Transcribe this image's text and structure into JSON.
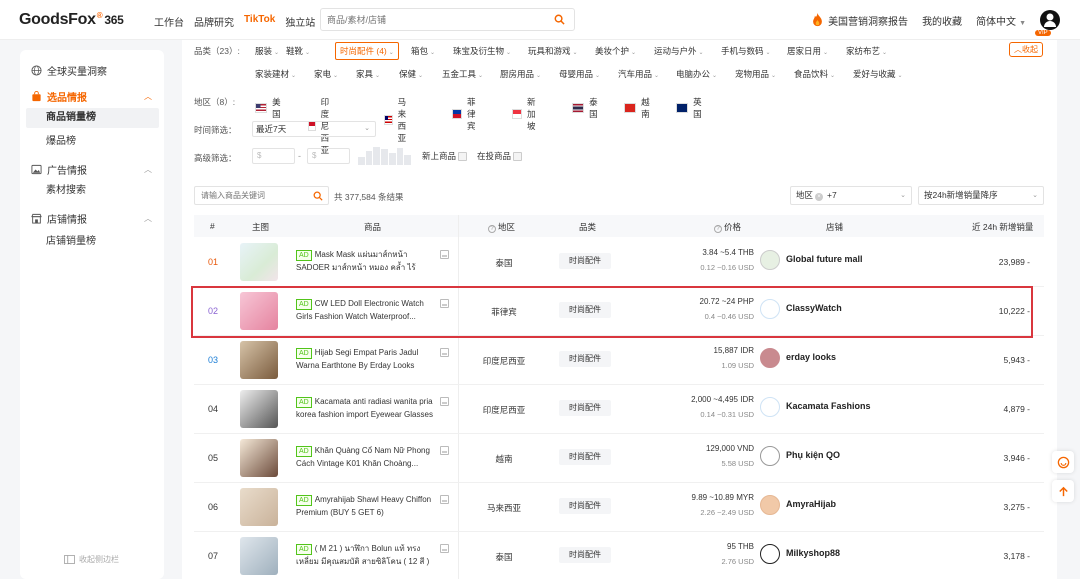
{
  "app": {
    "logo_text": "GoodsFox",
    "logo_mark": "®",
    "logo_num": "365",
    "nav": [
      "工作台",
      "品牌研究",
      "TikTok",
      "独立站"
    ],
    "nav_active": "TikTok",
    "search_placeholder": "商品/素材/店铺",
    "report_link": "美国营销洞察报告",
    "favorites": "我的收藏",
    "language": "简体中文",
    "vip": "VIP",
    "accent": "#f56600"
  },
  "sidebar": {
    "top_item": "全球买量洞察",
    "groups": [
      {
        "label": "选品情报",
        "active": true,
        "items": [
          "商品销量榜",
          "爆品榜"
        ],
        "active_item": "商品销量榜"
      },
      {
        "label": "广告情报",
        "active": false,
        "items": [
          "素材搜索"
        ]
      },
      {
        "label": "店铺情报",
        "active": false,
        "items": [
          "店铺销量榜"
        ]
      }
    ],
    "collapse_label": "收起侧边栏"
  },
  "filters": {
    "category_label": "品类（23）:",
    "categories_row1": [
      "服装",
      "鞋靴",
      "时尚配件 (4)",
      "箱包",
      "珠宝及衍生物",
      "玩具和游戏",
      "美妆个护",
      "运动与户外",
      "手机与数码",
      "居家日用",
      "家纺布艺"
    ],
    "categories_row2": [
      "家装建材",
      "家电",
      "家具",
      "保健",
      "五金工具",
      "厨房用品",
      "母婴用品",
      "汽车用品",
      "电脑办公",
      "宠物用品",
      "食品饮料",
      "爱好与收藏"
    ],
    "collapse_label": "收起",
    "region_label": "地区（8）:",
    "regions": [
      "美国",
      "印度尼西亚",
      "马来西亚",
      "菲律宾",
      "新加坡",
      "泰国",
      "越南",
      "英国"
    ],
    "time_label": "时间筛选：",
    "time_value": "最近7天",
    "advanced_label": "高级筛选：",
    "price_min_placeholder": "$",
    "price_max_placeholder": "$",
    "price_sep": "-",
    "new_products": "新上商品",
    "live_products": "在投商品"
  },
  "toolbar": {
    "keyword_placeholder": "请输入商品关键词",
    "result_count": "共 377,584 条结果",
    "region_filter_label": "地区",
    "region_filter_more": "+7",
    "sort_value": "按24h新增销量降序"
  },
  "table": {
    "headers": {
      "index": "#",
      "image": "主图",
      "product": "商品",
      "region": "地区",
      "category": "品类",
      "price": "价格",
      "shop": "店铺",
      "sales": "近 24h 新增销量"
    },
    "ad_badge": "AD",
    "rows": [
      {
        "rank": "01",
        "title": "Mask Mask แผ่นมาส์กหน้า SADOER มาส์กหน้า หมอง คล้ำ ไร้ความ...",
        "region": "泰国",
        "category": "时尚配件",
        "price_local": "3.84 ~5.4 THB",
        "price_usd": "0.12 ~0.16 USD",
        "shop": "Global future mall",
        "sales": "23,989 -",
        "rank_color": "#e8590c"
      },
      {
        "rank": "02",
        "title": "CW LED Doll Electronic Watch Girls Fashion Watch Waterproof...",
        "region": "菲律宾",
        "category": "时尚配件",
        "price_local": "20.72 ~24 PHP",
        "price_usd": "0.4 ~0.46 USD",
        "shop": "ClassyWatch",
        "sales": "10,222 -",
        "rank_color": "#8a63d2"
      },
      {
        "rank": "03",
        "title": "Hijab Segi Empat Paris Jadul Warna Earthtone By Erday Looks",
        "region": "印度尼西亚",
        "category": "时尚配件",
        "price_local": "15,887 IDR",
        "price_usd": "1.09 USD",
        "shop": "erday looks",
        "sales": "5,943 -",
        "rank_color": "#1c7ed6"
      },
      {
        "rank": "04",
        "title": "Kacamata anti radiasi wanita pria korea fashion import Eyewear Glasses",
        "region": "印度尼西亚",
        "category": "时尚配件",
        "price_local": "2,000 ~4,495 IDR",
        "price_usd": "0.14 ~0.31 USD",
        "shop": "Kacamata Fashions",
        "sales": "4,879 -",
        "rank_color": "#333333"
      },
      {
        "rank": "05",
        "title": "Khăn Quàng Cổ Nam Nữ Phong Cách Vintage K01 Khăn Choàng...",
        "region": "越南",
        "category": "时尚配件",
        "price_local": "129,000 VND",
        "price_usd": "5.58 USD",
        "shop": "Phụ kiện QO",
        "sales": "3,946 -",
        "rank_color": "#333333"
      },
      {
        "rank": "06",
        "title": "Amyrahijab Shawl Heavy Chiffon Premium (BUY 5 GET 6)",
        "region": "马来西亚",
        "category": "时尚配件",
        "price_local": "9.89 ~10.89 MYR",
        "price_usd": "2.26 ~2.49 USD",
        "shop": "AmyraHijab",
        "sales": "3,275 -",
        "rank_color": "#333333"
      },
      {
        "rank": "07",
        "title": "( M 21 ) นาฬิกา Bolun แท้ ทรง เหลี่ยม มีคุณสมบัติ สายซิลิโคน ( 12 สี )",
        "region": "泰国",
        "category": "时尚配件",
        "price_local": "95 THB",
        "price_usd": "2.76 USD",
        "shop": "Milkyshop88",
        "sales": "3,178 -",
        "rank_color": "#333333"
      }
    ]
  }
}
